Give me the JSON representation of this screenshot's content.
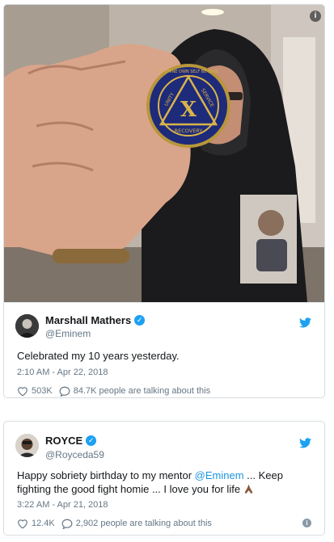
{
  "tweet1": {
    "name": "Marshall Mathers",
    "handle": "@Eminem",
    "text": "Celebrated my 10 years yesterday.",
    "timestamp": "2:10 AM - Apr 22, 2018",
    "likes": "503K",
    "talking": "84.7K people are talking about this",
    "photo_info_icon": "info-icon",
    "medallion": {
      "center": "X",
      "top_left": "UNITY",
      "top_right": "SERVICE",
      "bottom": "RECOVERY",
      "ring": "TO THINE OWN SELF BE TRUE"
    }
  },
  "tweet2": {
    "name": "ROYCE",
    "handle": "@Royceda59",
    "text_before": "Happy sobriety birthday to my mentor ",
    "mention": "@Eminem",
    "text_after": " ... Keep fighting the good fight homie ... I love you for life ",
    "timestamp": "3:22 AM - Apr 21, 2018",
    "likes": "12.4K",
    "talking": "2,902 people are talking about this"
  },
  "colors": {
    "twitter_blue": "#1da1f2",
    "mention": "#1b95e0",
    "meta_gray": "#657786",
    "border": "#d7dde2"
  }
}
